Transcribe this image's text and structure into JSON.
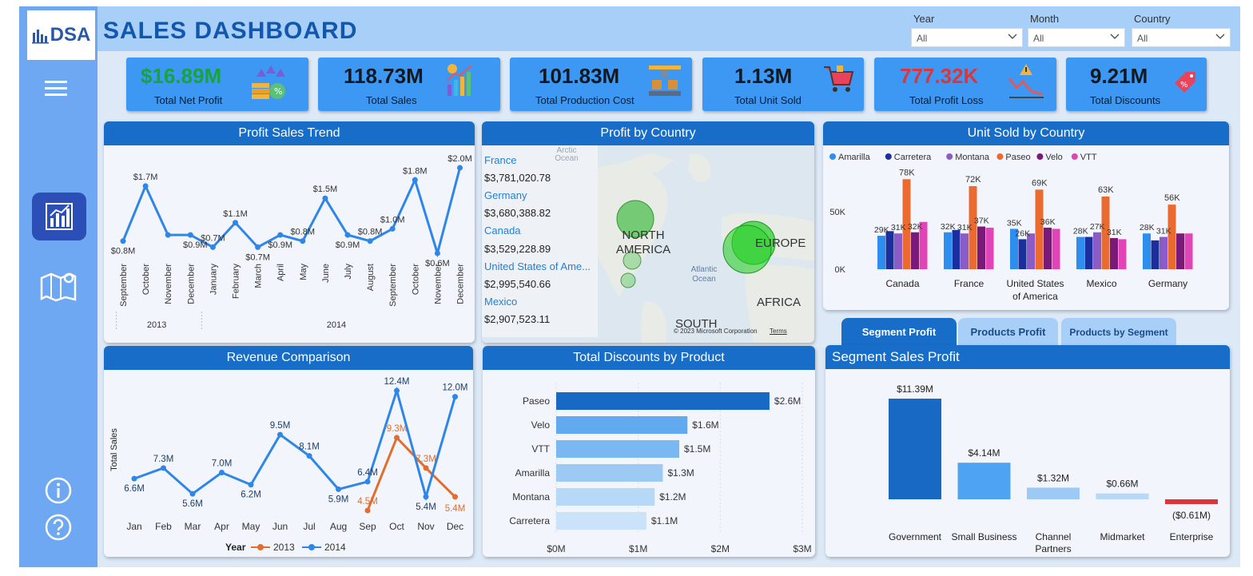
{
  "logo": {
    "text_a": "DSA"
  },
  "header": {
    "title": "SALES DASHBOARD"
  },
  "filters": [
    {
      "label": "Year",
      "value": "All"
    },
    {
      "label": "Month",
      "value": "All"
    },
    {
      "label": "Country",
      "value": "All"
    }
  ],
  "kpis": [
    {
      "value": "$16.89M",
      "label": "Total Net Profit",
      "color": "#1aa33a"
    },
    {
      "value": "118.73M",
      "label": "Total Sales",
      "color": "#101820"
    },
    {
      "value": "101.83M",
      "label": "Total Production Cost",
      "color": "#101820"
    },
    {
      "value": "1.13M",
      "label": "Total Unit Sold",
      "color": "#101820"
    },
    {
      "value": "777.32K",
      "label": "Total Profit Loss",
      "color": "#d9363e"
    },
    {
      "value": "9.21M",
      "label": "Total Discounts",
      "color": "#101820"
    }
  ],
  "cards": {
    "profit_trend": "Profit Sales Trend",
    "profit_country": "Profit by Country",
    "unit_country": "Unit Sold by Country",
    "revenue": "Revenue Comparison",
    "discounts": "Total Discounts by Product",
    "segment": "Segment Sales Profit"
  },
  "tabs": [
    "Segment Profit",
    "Products Profit",
    "Products by Segment"
  ],
  "map": {
    "countries": [
      {
        "name": "France",
        "value": "$3,781,020.78"
      },
      {
        "name": "Germany",
        "value": "$3,680,388.82"
      },
      {
        "name": "Canada",
        "value": "$3,529,228.89"
      },
      {
        "name": "United States of Ame...",
        "value": "$2,995,540.66"
      },
      {
        "name": "Mexico",
        "value": "$2,907,523.11"
      }
    ],
    "labels": {
      "arctic": "Arctic Ocean",
      "na": "NORTH AMERICA",
      "europe": "EUROPE",
      "atlantic": "Atlantic Ocean",
      "africa": "AFRICA",
      "sa": "SOUTH",
      "copyright": "© 2023 Microsoft Corporation",
      "terms": "Terms"
    }
  },
  "chart_data": [
    {
      "type": "line",
      "title": "Profit Sales Trend",
      "x": [
        "September",
        "October",
        "November",
        "December",
        "January",
        "February",
        "March",
        "April",
        "May",
        "June",
        "July",
        "August",
        "September",
        "October",
        "November",
        "December"
      ],
      "year_groups": [
        {
          "label": "2013",
          "count": 4
        },
        {
          "label": "2014",
          "count": 12
        }
      ],
      "series": [
        {
          "values": [
            0.8,
            1.7,
            0.9,
            0.9,
            0.7,
            1.1,
            0.7,
            0.9,
            0.8,
            1.5,
            0.9,
            0.8,
            1.0,
            1.8,
            0.6,
            2.0
          ]
        }
      ],
      "data_labels": [
        "$0.8M",
        "$1.7M",
        "",
        "$0.9M",
        "$0.7M",
        "$1.1M",
        "$0.7M",
        "$0.9M",
        "$0.8M",
        "$1.5M",
        "$0.9M",
        "$0.8M",
        "$1.0M",
        "$1.8M",
        "$0.6M",
        "$2.0M"
      ],
      "color": "#2e86e8"
    },
    {
      "type": "bar",
      "title": "Unit Sold by Country",
      "categories": [
        "Canada",
        "France",
        "United States of America",
        "Mexico",
        "Germany"
      ],
      "category_lines": [
        [
          "Canada"
        ],
        [
          "France"
        ],
        [
          "United States",
          "of America"
        ],
        [
          "Mexico"
        ],
        [
          "Germany"
        ]
      ],
      "series": [
        {
          "name": "Amarilla",
          "color": "#2d8ef0",
          "values": [
            29,
            32,
            35,
            28,
            31
          ]
        },
        {
          "name": "Carretera",
          "color": "#1a2e9e",
          "values": [
            33,
            34,
            26,
            28,
            25
          ]
        },
        {
          "name": "Montana",
          "color": "#8b5cc7",
          "values": [
            31,
            31,
            31,
            32,
            28
          ]
        },
        {
          "name": "Paseo",
          "color": "#ea6a30",
          "values": [
            78,
            72,
            69,
            63,
            56
          ]
        },
        {
          "name": "Velo",
          "color": "#7a1a78",
          "values": [
            32,
            37,
            36,
            27,
            31
          ]
        },
        {
          "name": "VTT",
          "color": "#e044b6",
          "values": [
            41,
            36,
            35,
            26,
            31
          ]
        }
      ],
      "data_labels": [
        "29K",
        "31K",
        "32K",
        "32K",
        "31K",
        "37K",
        "35K",
        "26K",
        "36K",
        "28K",
        "27K",
        "31K",
        "28K",
        "31K"
      ],
      "big_labels": [
        "78K",
        "72K",
        "69K",
        "63K",
        "56K"
      ],
      "yticks": [
        "0K",
        "50K"
      ],
      "ylim": [
        0,
        90
      ]
    },
    {
      "type": "line",
      "title": "Revenue Comparison",
      "ylabel": "Total Sales",
      "x": [
        "Jan",
        "Feb",
        "Mar",
        "Apr",
        "May",
        "Jun",
        "Jul",
        "Aug",
        "Sep",
        "Oct",
        "Nov",
        "Dec"
      ],
      "series": [
        {
          "name": "2013",
          "color": "#e06f2f",
          "values": [
            null,
            null,
            null,
            null,
            null,
            null,
            null,
            null,
            4.5,
            9.3,
            7.3,
            5.4
          ]
        },
        {
          "name": "2014",
          "color": "#2e86e8",
          "values": [
            6.6,
            7.3,
            5.6,
            7.0,
            6.2,
            9.5,
            8.1,
            5.9,
            6.4,
            12.4,
            5.4,
            12.0
          ]
        }
      ],
      "legend_title": "Year"
    },
    {
      "type": "bar",
      "title": "Total Discounts by Product",
      "categories": [
        "Paseo",
        "Velo",
        "VTT",
        "Amarilla",
        "Montana",
        "Carretera"
      ],
      "values": [
        2.6,
        1.6,
        1.5,
        1.3,
        1.2,
        1.1
      ],
      "labels": [
        "$2.6M",
        "$1.6M",
        "$1.5M",
        "$1.3M",
        "$1.2M",
        "$1.1M"
      ],
      "colors": [
        "#1769c4",
        "#62aaf0",
        "#7ab8f3",
        "#9ccaf5",
        "#b7d8f7",
        "#cbe3f9"
      ],
      "xticks": [
        "$0M",
        "$1M",
        "$2M",
        "$3M"
      ],
      "xlim": [
        0,
        3
      ]
    },
    {
      "type": "bar",
      "title": "Segment Sales Profit",
      "categories": [
        "Government",
        "Small Business",
        "Channel Partners",
        "Midmarket",
        "Enterprise"
      ],
      "category_lines": [
        [
          "Government"
        ],
        [
          "Small Business"
        ],
        [
          "Channel",
          "Partners"
        ],
        [
          "Midmarket"
        ],
        [
          "Enterprise"
        ]
      ],
      "values": [
        11.39,
        4.14,
        1.32,
        0.66,
        -0.61
      ],
      "labels": [
        "$11.39M",
        "$4.14M",
        "$1.32M",
        "$0.66M",
        "($0.61M)"
      ],
      "colors": [
        "#1769c4",
        "#4ea3f2",
        "#9ccaf5",
        "#b7d8f7",
        "#d9363e"
      ]
    }
  ]
}
